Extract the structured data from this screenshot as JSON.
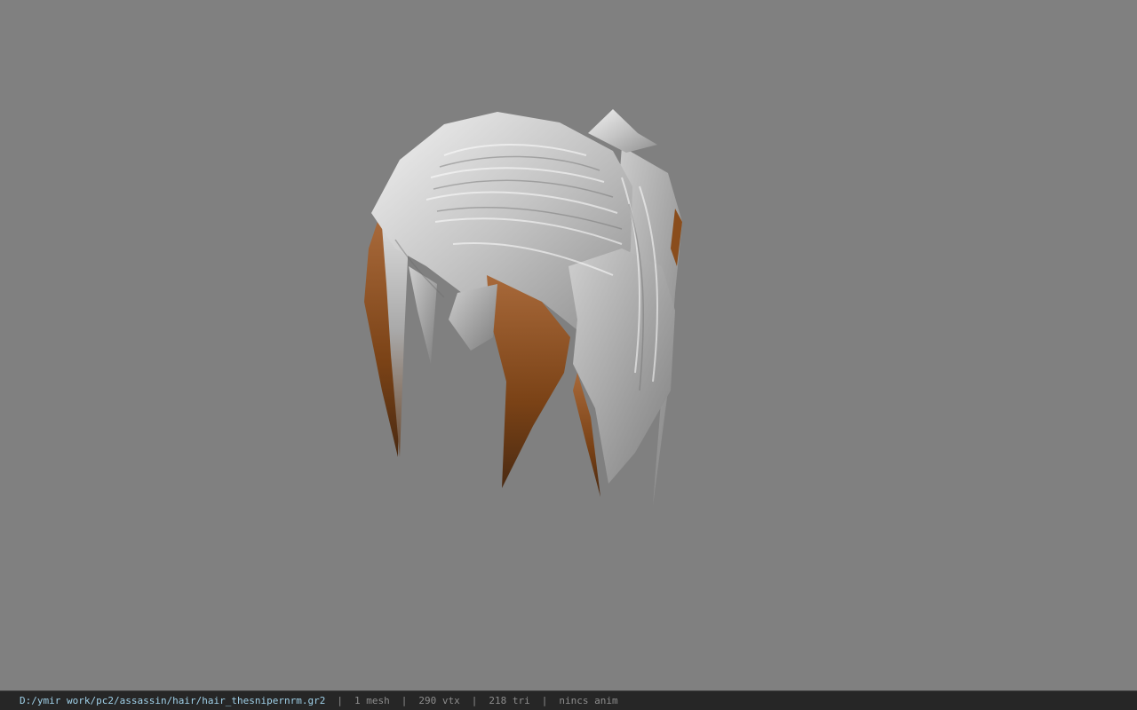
{
  "viewer": {
    "background_color": "#808080",
    "model": {
      "name": "hair-mesh",
      "hair_color": "#c9c9c9",
      "tip_color": "#8a4d1c"
    }
  },
  "status_bar": {
    "file_path": "D:/ymir work/pc2/assassin/hair/hair_thesnipernrm.gr2",
    "separator": "|",
    "mesh_count": "1 mesh",
    "vertex_count": "290 vtx",
    "triangle_count": "218 tri",
    "animation": "nincs anim"
  }
}
